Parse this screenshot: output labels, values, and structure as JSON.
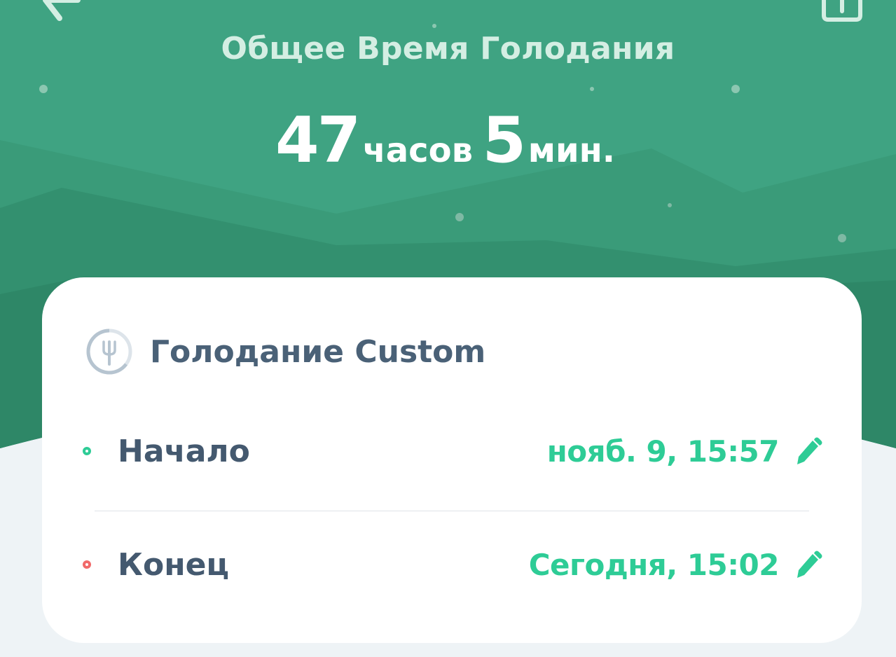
{
  "header": {
    "title": "Общее Время Голодания",
    "hours_value": "47",
    "hours_unit": "часов",
    "minutes_value": "5",
    "minutes_unit": "мин."
  },
  "fast_card": {
    "plan_title": "Голодание Custom",
    "start": {
      "label": "Начало",
      "value": "нояб. 9, 15:57"
    },
    "end": {
      "label": "Конец",
      "value": "Сегодня, 15:02"
    }
  },
  "icons": {
    "back": "back-arrow-icon",
    "share": "share-icon",
    "plan": "fork-icon",
    "edit": "pencil-icon"
  },
  "colors": {
    "header_green": "#3fa382",
    "accent_green": "#2ecc96",
    "end_dot_red": "#f16a6a",
    "text_slate": "#44596f"
  }
}
